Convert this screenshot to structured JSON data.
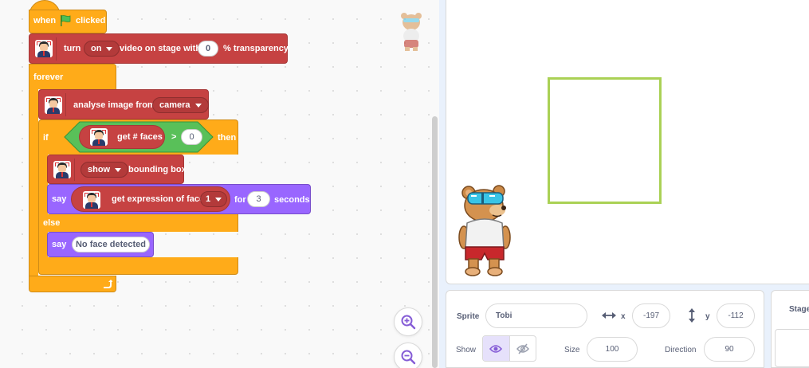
{
  "code": {
    "hat": {
      "when": "when",
      "clicked": "clicked"
    },
    "video_block": {
      "turn": "turn",
      "state": "on",
      "middle": "video on stage with",
      "transparency": "0",
      "suffix": "% transparency"
    },
    "forever": {
      "label": "forever"
    },
    "analyse_block": {
      "label": "analyse image from",
      "source": "camera"
    },
    "if_block": {
      "if": "if",
      "then": "then",
      "else": "else"
    },
    "condition": {
      "reporter": "get # faces",
      "operator": ">",
      "value": "0"
    },
    "bbox_block": {
      "option": "show",
      "label": "bounding box"
    },
    "say_expression": {
      "say": "say",
      "reporter": "get expression of face",
      "face_index": "1",
      "for": "for",
      "seconds_value": "3",
      "seconds": "seconds"
    },
    "say_noface": {
      "say": "say",
      "text": "No face detected"
    }
  },
  "sprite_info": {
    "sprite_label": "Sprite",
    "sprite_name": "Tobi",
    "x_label": "x",
    "x_value": "-197",
    "y_label": "y",
    "y_value": "-112",
    "show_label": "Show",
    "size_label": "Size",
    "size_value": "100",
    "direction_label": "Direction",
    "direction_value": "90"
  },
  "stage_panel": {
    "label": "Stage"
  },
  "colors": {
    "events": "#ffab19",
    "face_extension": "#c64242",
    "looks": "#9966ff",
    "operators": "#59c059",
    "bounding_box": "#aad155"
  },
  "icons": [
    "green-flag-icon",
    "face-detection-icon",
    "dropdown-caret-icon",
    "loop-arrow-icon",
    "zoom-in-icon",
    "zoom-out-icon",
    "horizontal-arrows-icon",
    "vertical-arrows-icon",
    "eye-icon",
    "eye-slash-icon"
  ]
}
